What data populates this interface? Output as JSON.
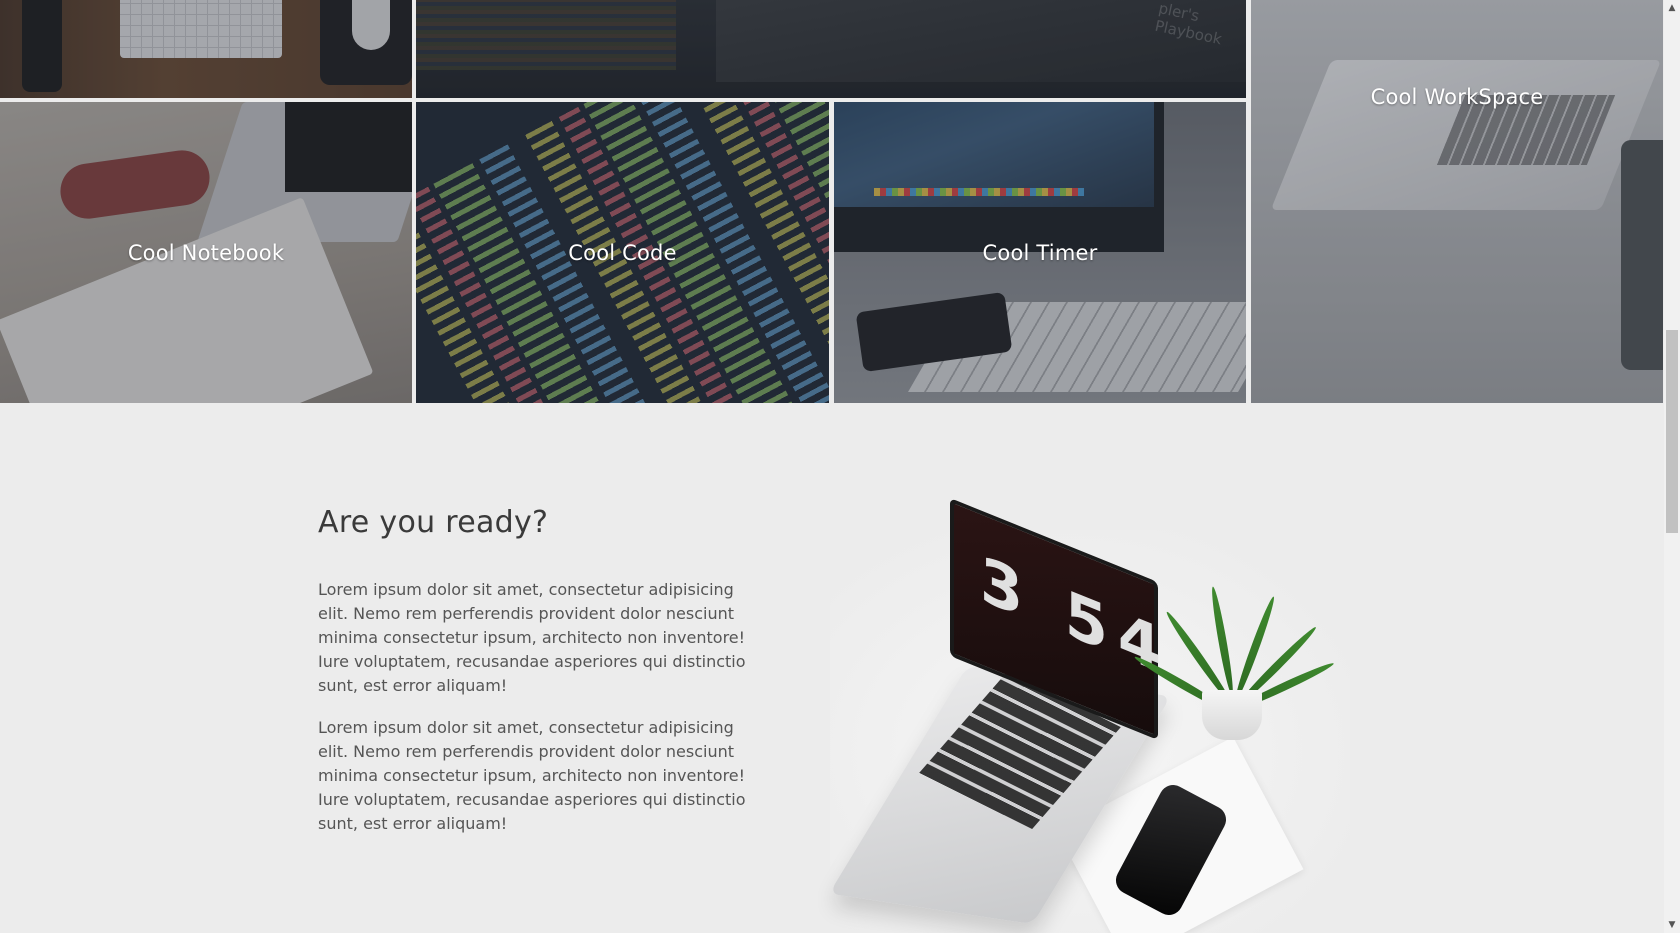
{
  "portfolio": {
    "tiles": [
      {
        "caption": ""
      },
      {
        "caption": ""
      },
      {
        "caption": "Cool WorkSpace"
      },
      {
        "caption": "Cool Notebook"
      },
      {
        "caption": "Cool Code"
      },
      {
        "caption": "Cool Timer"
      }
    ],
    "book_text": "pler's Playbook"
  },
  "ready": {
    "heading": "Are you ready?",
    "paragraphs": [
      "Lorem ipsum dolor sit amet, consectetur adipisicing elit. Nemo rem perferendis provident dolor nesciunt minima consectetur ipsum, architecto non inventore! Iure voluptatem, recusandae asperiores qui distinctio sunt, est error aliquam!",
      "Lorem ipsum dolor sit amet, consectetur adipisicing elit. Nemo rem perferendis provident dolor nesciunt minima consectetur ipsum, architecto non inventore! Iure voluptatem, recusandae asperiores qui distinctio sunt, est error aliquam!"
    ]
  },
  "hero": {
    "clock_text": "3 54"
  },
  "scrollbar": {
    "up_icon": "chevron-up-icon",
    "down_icon": "chevron-down-icon",
    "up_glyph": "▲",
    "down_glyph": "▼"
  },
  "colors": {
    "background": "#ececec",
    "heading": "#3a3a3a",
    "body_text": "#555555",
    "caption": "#ffffff"
  }
}
